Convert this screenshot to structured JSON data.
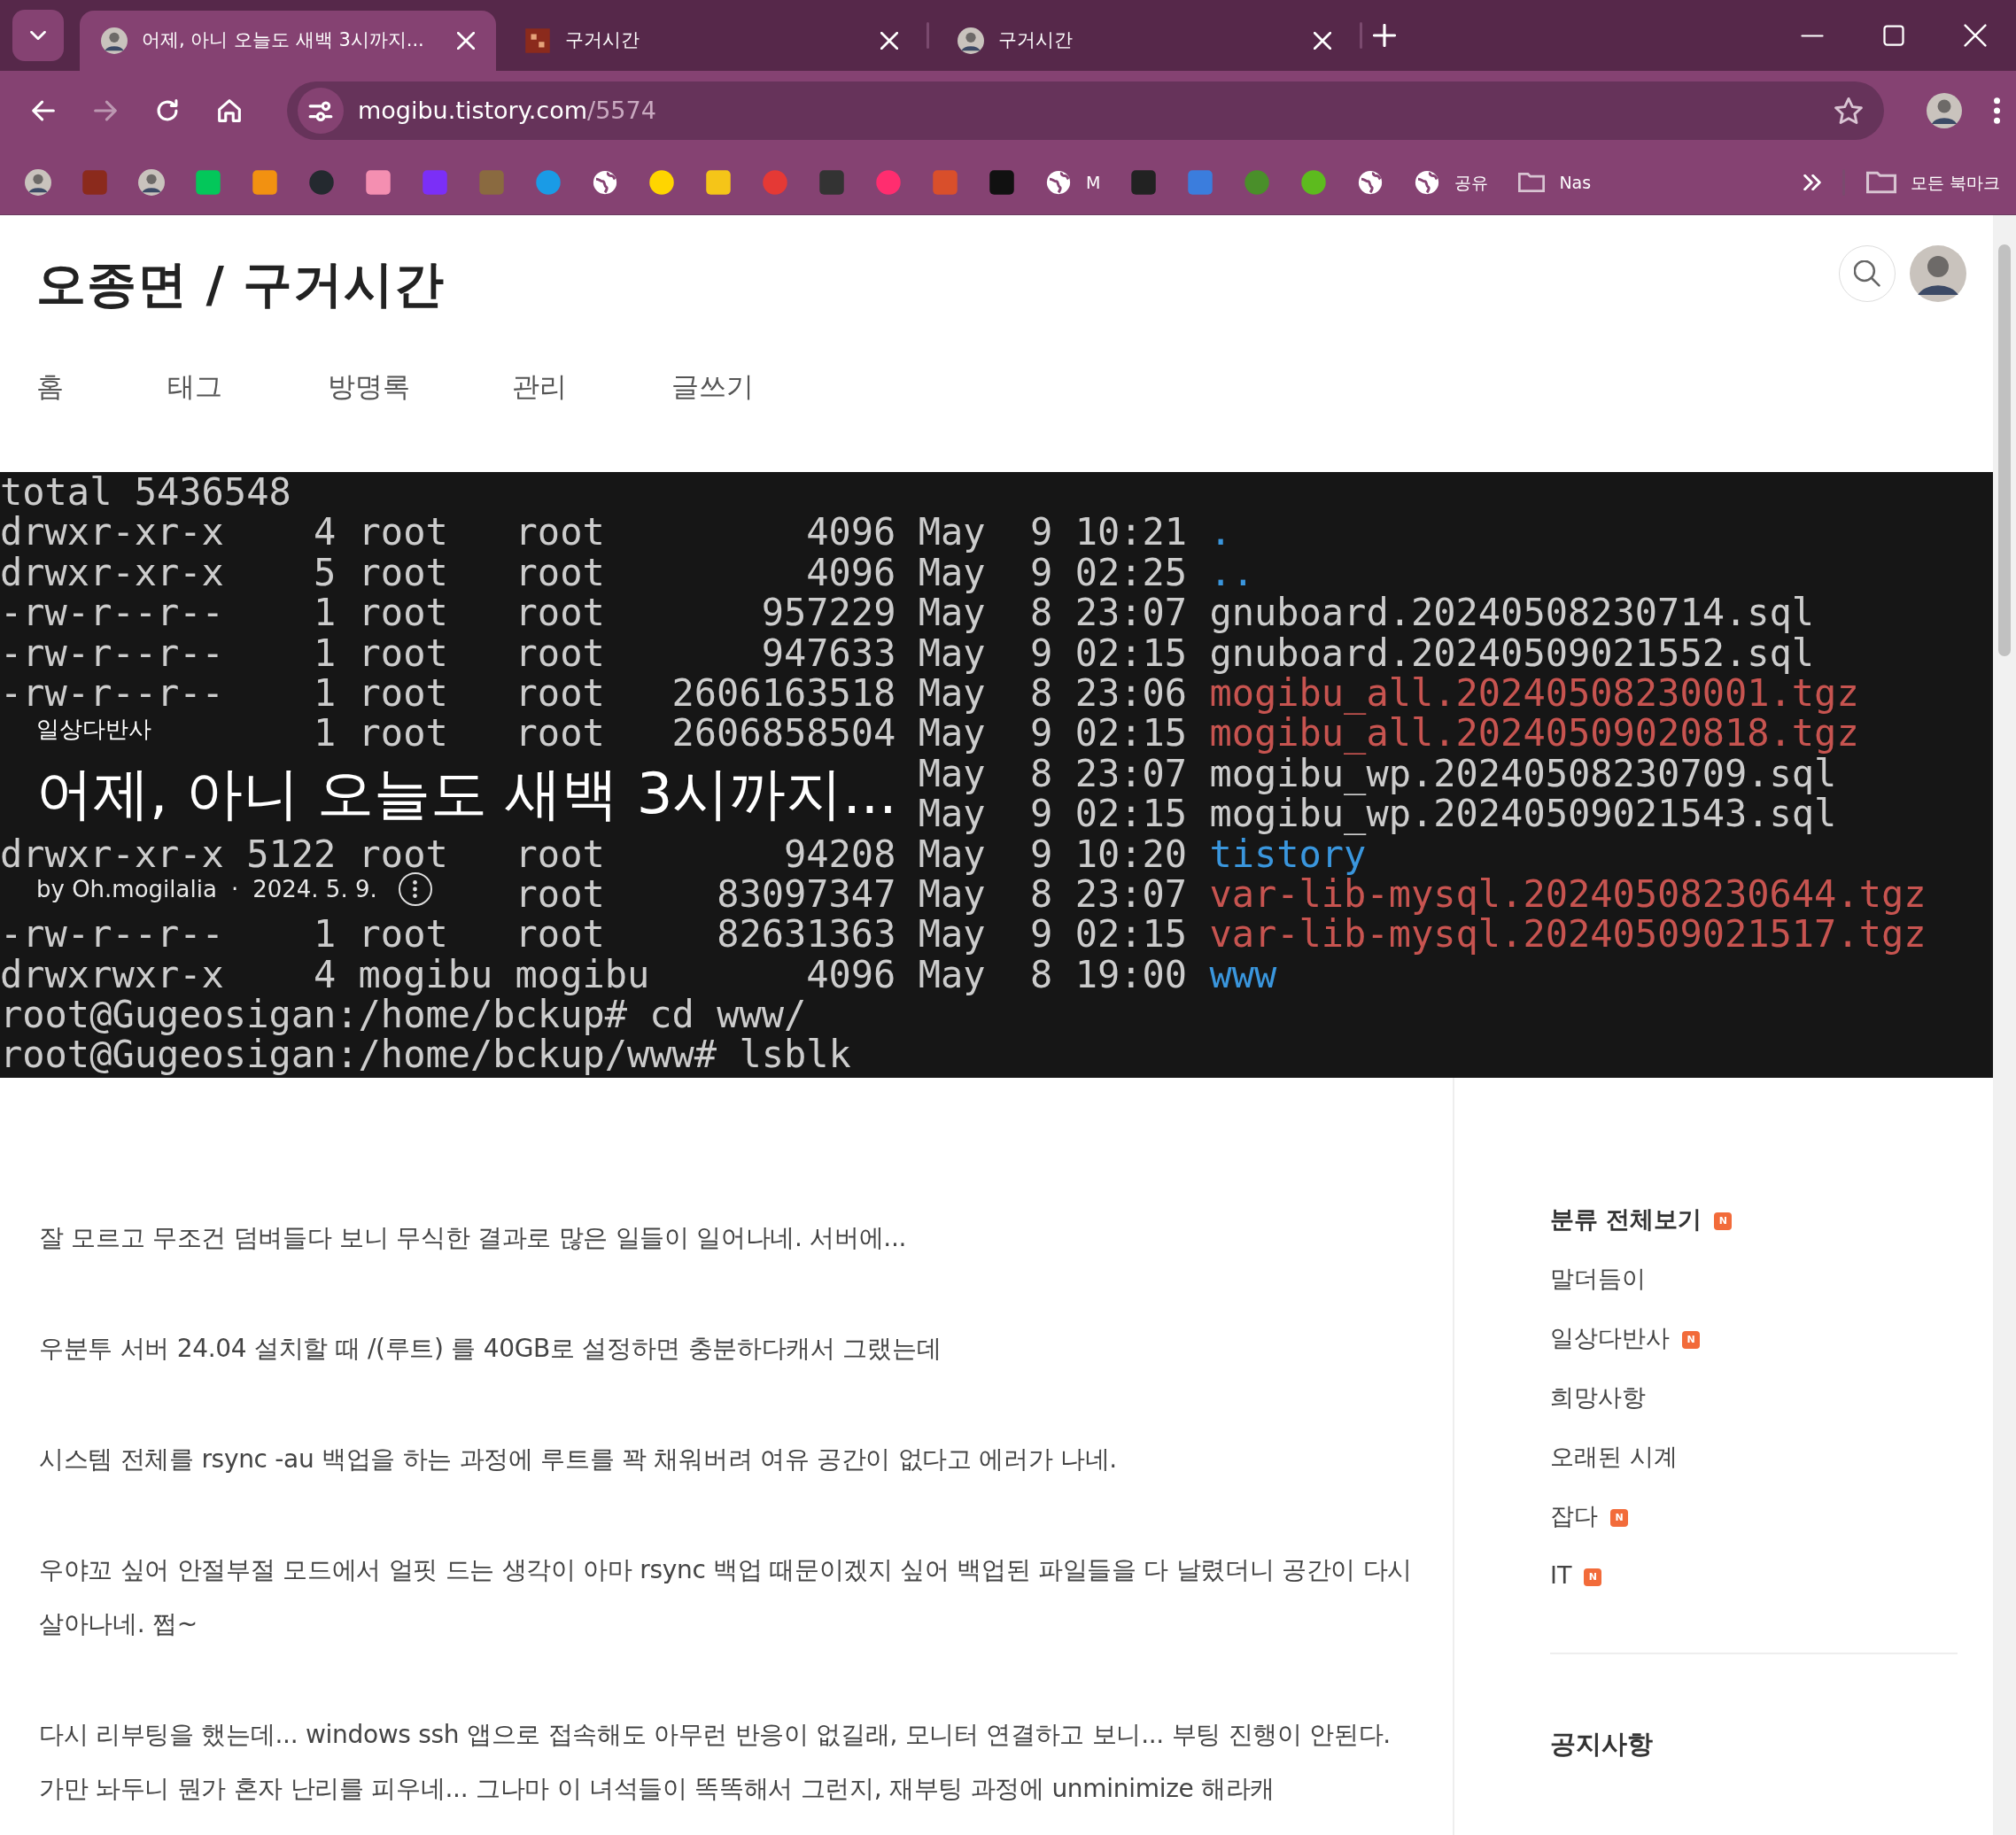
{
  "browser": {
    "tabs": [
      {
        "title": "어제, 아니 오늘도 새백 3시까지...",
        "selected": true,
        "kind": "avatar"
      },
      {
        "title": "구거시간",
        "selected": false,
        "kind": "seal"
      },
      {
        "title": "구거시간",
        "selected": false,
        "kind": "avatar"
      }
    ],
    "toolbar_buttons": [
      {
        "kind": "back",
        "disabled": false
      },
      {
        "kind": "forward",
        "disabled": true
      },
      {
        "kind": "reload",
        "disabled": false
      },
      {
        "kind": "home",
        "disabled": false
      }
    ],
    "address": {
      "host": "mogibu.tistory.com",
      "path": "/5574"
    },
    "bookmarks": [
      {
        "kind": "avatar"
      },
      {
        "kind": "square",
        "color": "#8b2a1c"
      },
      {
        "kind": "avatar"
      },
      {
        "kind": "square",
        "color": "#03c75a"
      },
      {
        "kind": "square",
        "color": "#f29111"
      },
      {
        "kind": "circle",
        "color": "#24292f"
      },
      {
        "kind": "square",
        "color": "#f48fb1"
      },
      {
        "kind": "square",
        "color": "#7b2ff7"
      },
      {
        "kind": "square",
        "color": "#8a6a40"
      },
      {
        "kind": "circle",
        "color": "#1a9be6"
      },
      {
        "kind": "globe"
      },
      {
        "kind": "circle",
        "color": "#ffd500"
      },
      {
        "kind": "square",
        "color": "#f5c518"
      },
      {
        "kind": "circle",
        "color": "#e53935"
      },
      {
        "kind": "square",
        "color": "#333333"
      },
      {
        "kind": "circle",
        "color": "#ff2d6f"
      },
      {
        "kind": "square",
        "color": "#d94f2b"
      },
      {
        "kind": "square",
        "color": "#111111"
      },
      {
        "kind": "globe",
        "label": "M"
      },
      {
        "kind": "square",
        "color": "#222222"
      },
      {
        "kind": "square",
        "color": "#3b7ddd"
      },
      {
        "kind": "circle",
        "color": "#4a8f2a"
      },
      {
        "kind": "circle",
        "color": "#5dbb1e"
      },
      {
        "kind": "globe"
      },
      {
        "kind": "globe",
        "label": "공유"
      },
      {
        "kind": "folder",
        "label": "Nas"
      }
    ],
    "all_bookmarks": {
      "label": "모든 북마크"
    }
  },
  "blog": {
    "title": "오종면 / 구거시간",
    "menu": [
      "홈",
      "태그",
      "방명록",
      "관리",
      "글쓰기"
    ]
  },
  "post": {
    "category": "일상다반사",
    "title": "어제, 아니 오늘도 새백 3시까지...",
    "author": "by Oh.mogilalia",
    "separator": "·",
    "date": "2024. 5. 9.",
    "terminal": [
      {
        "kind": "plain",
        "text": "total 5436548"
      },
      {
        "kind": "dir",
        "perms": "drwxr-xr-x",
        "links": "4",
        "owner": "root",
        "group": "root",
        "size": "4096",
        "month": "May",
        "day": "9",
        "time": "10:21",
        "name": "."
      },
      {
        "kind": "dir",
        "perms": "drwxr-xr-x",
        "links": "5",
        "owner": "root",
        "group": "root",
        "size": "4096",
        "month": "May",
        "day": "9",
        "time": "02:25",
        "name": ".."
      },
      {
        "kind": "file",
        "perms": "-rw-r--r--",
        "links": "1",
        "owner": "root",
        "group": "root",
        "size": "957229",
        "month": "May",
        "day": "8",
        "time": "23:07",
        "name": "gnuboard.20240508230714.sql"
      },
      {
        "kind": "file",
        "perms": "-rw-r--r--",
        "links": "1",
        "owner": "root",
        "group": "root",
        "size": "947633",
        "month": "May",
        "day": "9",
        "time": "02:15",
        "name": "gnuboard.20240509021552.sql"
      },
      {
        "kind": "archive",
        "perms": "-rw-r--r--",
        "links": "1",
        "owner": "root",
        "group": "root",
        "size": "2606163518",
        "month": "May",
        "day": "8",
        "time": "23:06",
        "name": "mogibu_all.20240508230001.tgz"
      },
      {
        "kind": "archive",
        "links": "1",
        "owner": "root",
        "group": "root",
        "size": "2606858504",
        "month": "May",
        "day": "9",
        "time": "02:15",
        "name": "mogibu_all.20240509020818.tgz"
      },
      {
        "kind": "file",
        "month": "May",
        "day": "8",
        "time": "23:07",
        "name": "mogibu_wp.20240508230709.sql"
      },
      {
        "kind": "file",
        "month": "May",
        "day": "9",
        "time": "02:15",
        "name": "mogibu_wp.20240509021543.sql"
      },
      {
        "kind": "dir",
        "perms": "drwxr-xr-x",
        "links": "5122",
        "owner": "root",
        "group": "root",
        "size": "94208",
        "month": "May",
        "day": "9",
        "time": "10:20",
        "name": "tistory"
      },
      {
        "kind": "archive",
        "group": "root",
        "size": "83097347",
        "month": "May",
        "day": "8",
        "time": "23:07",
        "name": "var-lib-mysql.20240508230644.tgz"
      },
      {
        "kind": "archive",
        "perms": "-rw-r--r--",
        "links": "1",
        "owner": "root",
        "group": "root",
        "size": "82631363",
        "month": "May",
        "day": "9",
        "time": "02:15",
        "name": "var-lib-mysql.20240509021517.tgz"
      },
      {
        "kind": "dir",
        "perms": "drwxrwxr-x",
        "links": "4",
        "owner": "mogibu",
        "group": "mogibu",
        "size": "4096",
        "month": "May",
        "day": "8",
        "time": "19:00",
        "name": "www"
      },
      {
        "kind": "plain",
        "text": "root@Gugeosigan:/home/bckup# cd www/"
      },
      {
        "kind": "plain",
        "text": "root@Gugeosigan:/home/bckup/www# lsblk"
      }
    ],
    "paragraphs": [
      "잘 모르고 무조건 덤벼들다 보니 무식한 결과로 많은 일들이 일어나네. 서버에...",
      "우분투 서버 24.04 설치할 때 /(루트) 를 40GB로 설정하면 충분하다캐서 그랬는데",
      "시스템 전체를 rsync -au 백업을 하는 과정에 루트를 꽉 채워버려 여유 공간이 없다고 에러가 나네.",
      "우야꼬 싶어 안절부절 모드에서 얼핏 드는 생각이 아마 rsync 백업 때문이겠지 싶어 백업된 파일들을 다 날렸더니 공간이 다시 살아나네. 쩝~",
      "다시 리부팅을 했는데... windows ssh 앱으로 접속해도 아무런 반응이 없길래, 모니터 연결하고 보니... 부팅 진행이 안된다. 가만 놔두니 뭔가 혼자 난리를 피우네... 그나마 이 녀석들이 똑똑해서 그런지, 재부팅 과정에 unminimize 해라캐"
    ]
  },
  "sidebar": {
    "categories": [
      {
        "label": "분류 전체보기",
        "kind": "header",
        "badge": "N"
      },
      {
        "label": "말더듬이",
        "kind": "item"
      },
      {
        "label": "일상다반사",
        "kind": "item",
        "badge": "N"
      },
      {
        "label": "희망사항",
        "kind": "item"
      },
      {
        "label": "오래된 시계",
        "kind": "item"
      },
      {
        "label": "잡다",
        "kind": "item",
        "badge": "N"
      },
      {
        "label": "IT",
        "kind": "item",
        "badge": "N"
      }
    ],
    "notice_title": "공지사항"
  }
}
